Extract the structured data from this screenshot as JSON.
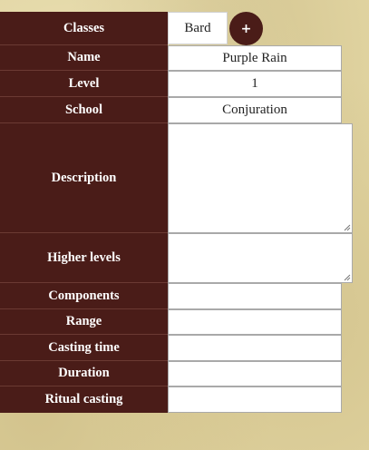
{
  "form": {
    "classes_label": "Classes",
    "classes_value": "Bard",
    "add_button": "+",
    "name_label": "Name",
    "name_value": "Purple Rain",
    "level_label": "Level",
    "level_value": "1",
    "school_label": "School",
    "school_value": "Conjuration",
    "description_label": "Description",
    "description_value": "",
    "higher_levels_label": "Higher levels",
    "higher_levels_value": "",
    "components_label": "Components",
    "components_value": "",
    "range_label": "Range",
    "range_value": "",
    "casting_time_label": "Casting time",
    "casting_time_value": "",
    "duration_label": "Duration",
    "duration_value": "",
    "ritual_label": "Ritual casting",
    "ritual_value": ""
  },
  "colors": {
    "label_bg": "#4a1c18",
    "page_bg": "#e0d3a0"
  }
}
